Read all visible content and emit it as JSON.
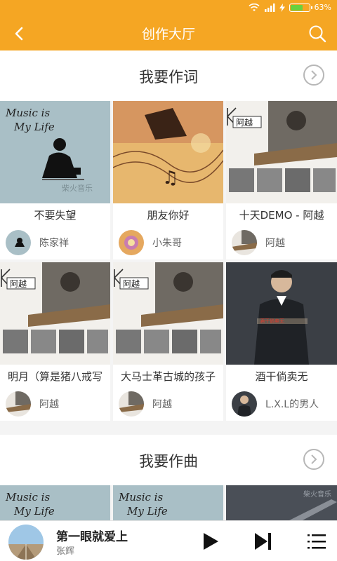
{
  "status": {
    "battery": "63%",
    "battery_level": 0.63
  },
  "header": {
    "title": "创作大厅"
  },
  "lyrics_section": {
    "title": "我要作词",
    "items": [
      {
        "song": "不要失望",
        "author": "陈家祥"
      },
      {
        "song": "朋友你好",
        "author": "小朱哥"
      },
      {
        "song": "十天DEMO - 阿越",
        "author": "阿越"
      },
      {
        "song": "明月（算是猪八戒写",
        "author": "阿越"
      },
      {
        "song": "大马士革古城的孩子",
        "author": "阿越"
      },
      {
        "song": "酒干倘卖无",
        "author": "L.X.L的男人"
      }
    ]
  },
  "compose_section": {
    "title": "我要作曲"
  },
  "player": {
    "title": "第一眼就爱上",
    "artist": "张辉"
  },
  "colors": {
    "accent": "#f5a623",
    "battery": "#6ad13e"
  },
  "icons": [
    "back-icon",
    "search-icon",
    "chevron-right-icon",
    "play-icon",
    "next-icon",
    "playlist-icon",
    "wifi-icon",
    "signal-icon",
    "charging-icon"
  ]
}
